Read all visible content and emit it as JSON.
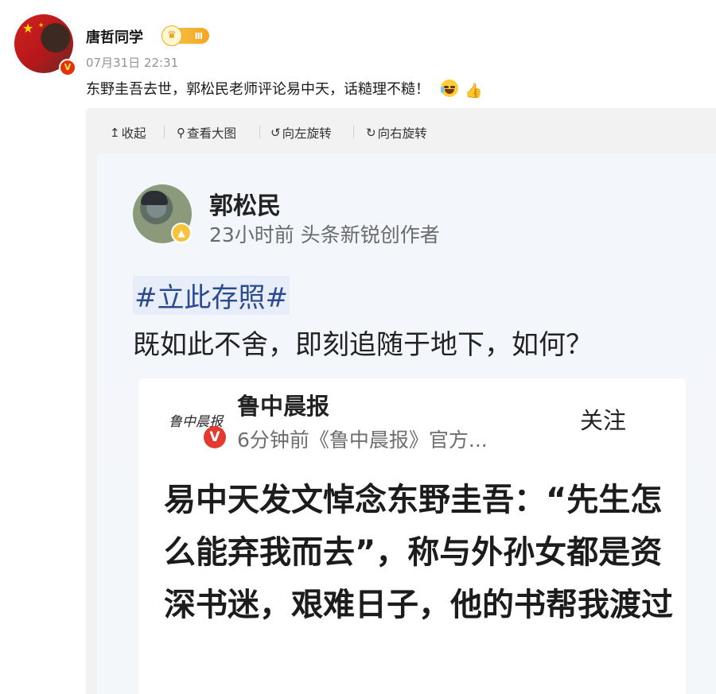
{
  "post": {
    "author": "唐哲同学",
    "level_badge": "Ⅲ",
    "date": "07月31日 22:31",
    "text": "东野圭吾去世，郭松民老师评论易中天，话糙理不糙！",
    "emojis": [
      "grin-sweat-emoji",
      "thumbs-up-emoji"
    ]
  },
  "toolbar": {
    "collapse": "收起",
    "view_large": "查看大图",
    "rotate_left": "向左旋转",
    "rotate_right": "向右旋转"
  },
  "screenshot": {
    "name": "郭松民",
    "meta": "23小时前 头条新锐创作者",
    "hashtag": "#立此存照#",
    "body": "既如此不舍，即刻追随于地下，如何？",
    "quoted": {
      "logo_text": "鲁中晨报",
      "name": "鲁中晨报",
      "verified": "V",
      "meta": "6分钟前《鲁中晨报》官方...",
      "follow": "关注",
      "headline": "易中天发文悼念东野圭吾：“先生怎么能弃我而去”，称与外孙女都是资深书迷，艰难日子，他的书帮我渡过"
    }
  }
}
